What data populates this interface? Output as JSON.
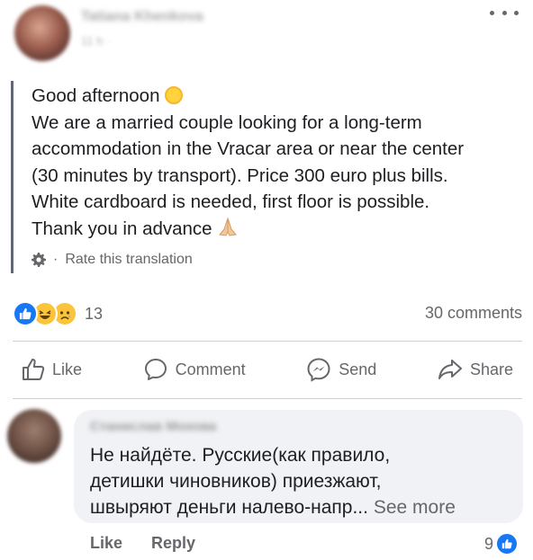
{
  "post": {
    "author": "Tatiana Khenkova",
    "meta": "11 h · ",
    "lines": [
      "Good afternoon",
      "We are a married couple looking for a long-term",
      "accommodation in the Vracar area or near the center",
      "(30 minutes by transport). Price 300 euro plus bills.",
      "White cardboard is needed, first floor is possible.",
      "Thank you in advance"
    ],
    "rate_translation": "Rate this translation",
    "rate_separator": "·"
  },
  "stats": {
    "reaction_count": "13",
    "comments_count": "30 comments"
  },
  "actions": {
    "like": "Like",
    "comment": "Comment",
    "send": "Send",
    "share": "Share"
  },
  "comment": {
    "author": "Станислав Мохова",
    "lines": [
      "Не найдёте. Русские(как правило,",
      "детишки чиновников) приезжают,",
      "швыряют деньги налево-напр..."
    ],
    "see_more": "See more",
    "like_label": "Like",
    "reply_label": "Reply",
    "reaction_count": "9"
  },
  "icons": {
    "more": "more-dots-icon",
    "sun": "sun-emoji",
    "hands": "folded-hands-emoji",
    "gear": "gear-icon",
    "like": "thumbs-up-icon",
    "comment": "comment-bubble-icon",
    "send": "messenger-icon",
    "share": "share-arrow-icon"
  },
  "colors": {
    "accent": "#1877f2",
    "muted_text": "#65676b",
    "bubble": "#f0f2f5"
  }
}
